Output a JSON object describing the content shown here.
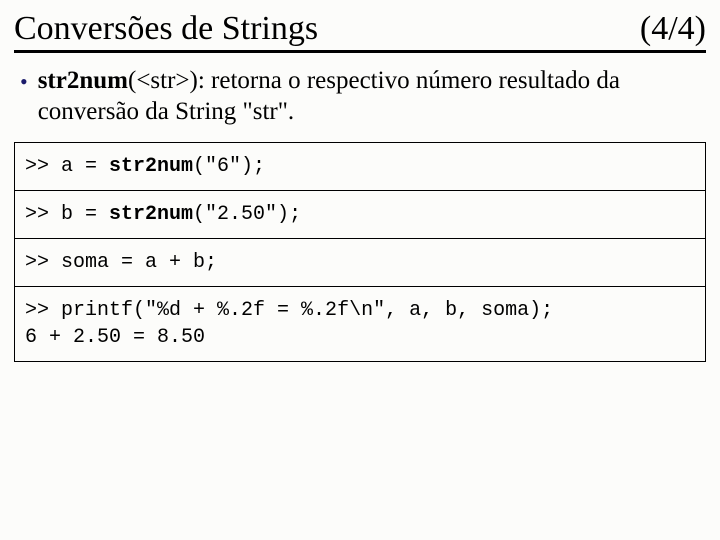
{
  "header": {
    "title": "Conversões de Strings",
    "pager": "(4/4)"
  },
  "bullet": {
    "fn": "str2num",
    "arg": "(<str>)",
    "desc": ": retorna o respectivo número resultado da conversão da String \"str\"."
  },
  "code": {
    "box1": {
      "prompt": ">>",
      "pre": " a = ",
      "kw": "str2num",
      "post": "(\"6\");"
    },
    "box2": {
      "prompt": ">>",
      "pre": " b = ",
      "kw": "str2num",
      "post": "(\"2.50\");"
    },
    "box3": {
      "prompt": ">>",
      "line": " soma = a + b;"
    },
    "box4": {
      "prompt": ">>",
      "line": " printf(\"%d + %.2f = %.2f\\n\", a, b, soma);",
      "result": "6 + 2.50 = 8.50"
    }
  }
}
